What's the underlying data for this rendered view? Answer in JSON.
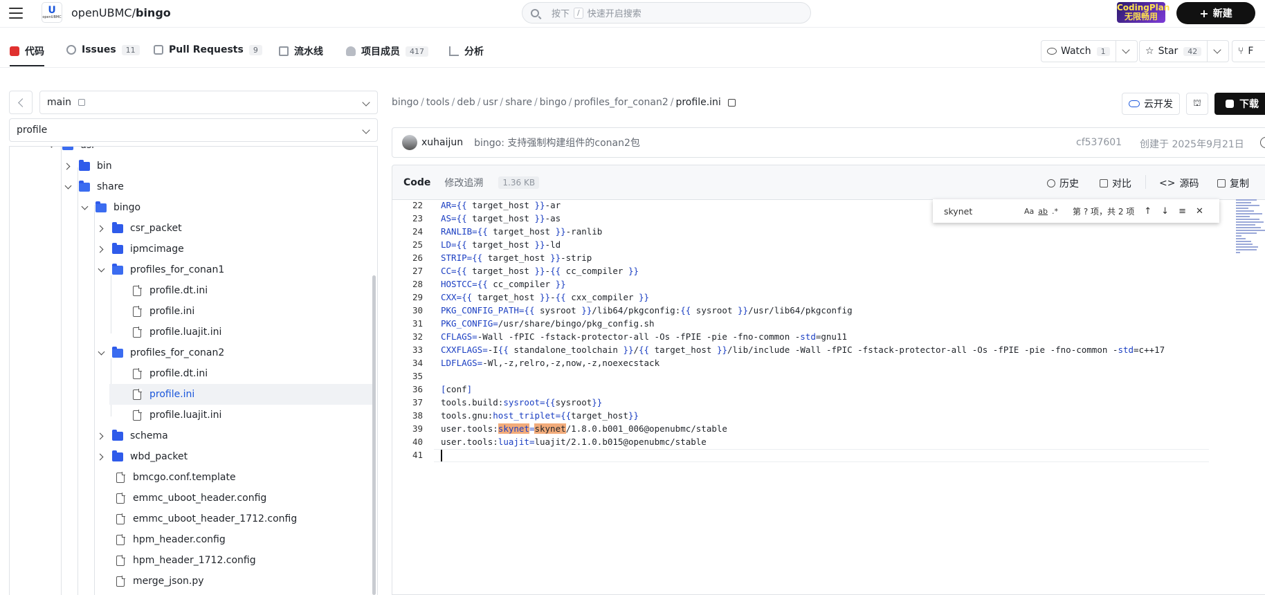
{
  "header": {
    "repo_owner": "openUBMC",
    "repo_sep": "/",
    "repo_name": "bingo",
    "logo_text": "openUBMC",
    "search": {
      "prefix": "按下",
      "key": "/",
      "suffix": "快速开启搜索"
    },
    "promo": {
      "line1": "CodingPlan",
      "line2": "无限畅用"
    },
    "new_label": "新建"
  },
  "tabs": [
    {
      "label": "代码",
      "count": null,
      "icon": "code-icon"
    },
    {
      "label": "Issues",
      "count": "11",
      "icon": "issue-icon"
    },
    {
      "label": "Pull Requests",
      "count": "9",
      "icon": "pr-icon"
    },
    {
      "label": "流水线",
      "count": null,
      "icon": "pipeline-icon"
    },
    {
      "label": "项目成员",
      "count": "417",
      "icon": "members-icon"
    },
    {
      "label": "分析",
      "count": null,
      "icon": "chart-icon"
    }
  ],
  "repo_actions": {
    "watch_label": "Watch",
    "watch_count": "1",
    "star_label": "Star",
    "star_count": "42",
    "fork_label": "F"
  },
  "branch": {
    "name": "main"
  },
  "filter": {
    "value": "profile"
  },
  "tree": [
    {
      "label": "usr",
      "type": "folder",
      "state": "open"
    },
    {
      "label": "bin",
      "type": "folder",
      "state": "closed"
    },
    {
      "label": "share",
      "type": "folder",
      "state": "open"
    },
    {
      "label": "bingo",
      "type": "folder",
      "state": "open"
    },
    {
      "label": "csr_packet",
      "type": "folder",
      "state": "closed"
    },
    {
      "label": "ipmcimage",
      "type": "folder",
      "state": "closed"
    },
    {
      "label": "profiles_for_conan1",
      "type": "folder",
      "state": "open"
    },
    {
      "label": "profile.dt.ini",
      "type": "file"
    },
    {
      "label": "profile.ini",
      "type": "file"
    },
    {
      "label": "profile.luajit.ini",
      "type": "file"
    },
    {
      "label": "profiles_for_conan2",
      "type": "folder",
      "state": "open"
    },
    {
      "label": "profile.dt.ini",
      "type": "file"
    },
    {
      "label": "profile.ini",
      "type": "file",
      "selected": true
    },
    {
      "label": "profile.luajit.ini",
      "type": "file"
    },
    {
      "label": "schema",
      "type": "folder",
      "state": "closed"
    },
    {
      "label": "wbd_packet",
      "type": "folder",
      "state": "closed"
    },
    {
      "label": "bmcgo.conf.template",
      "type": "file"
    },
    {
      "label": "emmc_uboot_header.config",
      "type": "file"
    },
    {
      "label": "emmc_uboot_header_1712.config",
      "type": "file"
    },
    {
      "label": "hpm_header.config",
      "type": "file"
    },
    {
      "label": "hpm_header_1712.config",
      "type": "file"
    },
    {
      "label": "merge_json.py",
      "type": "file"
    }
  ],
  "breadcrumb": [
    "bingo",
    "tools",
    "deb",
    "usr",
    "share",
    "bingo",
    "profiles_for_conan2",
    "profile.ini"
  ],
  "file_actions": {
    "cloud_label": "云开发",
    "download_label": "下载"
  },
  "commit": {
    "author": "xuhaijun",
    "message": "bingo: 支持强制构建组件的conan2包",
    "hash": "cf537601",
    "date": "创建于 2025年9月21日"
  },
  "code_header": {
    "tab_code": "Code",
    "tab_blame": "修改追溯",
    "size": "1.36 KB",
    "history": "历史",
    "compare": "对比",
    "source": "源码",
    "copy": "复制"
  },
  "find_widget": {
    "query": "skynet",
    "opt_case": "Aa",
    "opt_word": "ab",
    "opt_regex": ".*",
    "result": "第 ? 项，共 2 项"
  },
  "code_lines": [
    {
      "n": "22",
      "segs": [
        [
          "k",
          "AR="
        ],
        [
          "k",
          "{{"
        ],
        [
          "t",
          " target_host "
        ],
        [
          "k",
          "}}"
        ],
        [
          "t",
          "-ar"
        ]
      ]
    },
    {
      "n": "23",
      "segs": [
        [
          "k",
          "AS="
        ],
        [
          "k",
          "{{"
        ],
        [
          "t",
          " target_host "
        ],
        [
          "k",
          "}}"
        ],
        [
          "t",
          "-as"
        ]
      ]
    },
    {
      "n": "24",
      "segs": [
        [
          "k",
          "RANLIB="
        ],
        [
          "k",
          "{{"
        ],
        [
          "t",
          " target_host "
        ],
        [
          "k",
          "}}"
        ],
        [
          "t",
          "-ranlib"
        ]
      ]
    },
    {
      "n": "25",
      "segs": [
        [
          "k",
          "LD="
        ],
        [
          "k",
          "{{"
        ],
        [
          "t",
          " target_host "
        ],
        [
          "k",
          "}}"
        ],
        [
          "t",
          "-ld"
        ]
      ]
    },
    {
      "n": "26",
      "segs": [
        [
          "k",
          "STRIP="
        ],
        [
          "k",
          "{{"
        ],
        [
          "t",
          " target_host "
        ],
        [
          "k",
          "}}"
        ],
        [
          "t",
          "-strip"
        ]
      ]
    },
    {
      "n": "27",
      "segs": [
        [
          "k",
          "CC="
        ],
        [
          "k",
          "{{"
        ],
        [
          "t",
          " target_host "
        ],
        [
          "k",
          "}}"
        ],
        [
          "t",
          "-"
        ],
        [
          "k",
          "{{"
        ],
        [
          "t",
          " cc_compiler "
        ],
        [
          "k",
          "}}"
        ]
      ]
    },
    {
      "n": "28",
      "segs": [
        [
          "k",
          "HOSTCC="
        ],
        [
          "k",
          "{{"
        ],
        [
          "t",
          " cc_compiler "
        ],
        [
          "k",
          "}}"
        ]
      ]
    },
    {
      "n": "29",
      "segs": [
        [
          "k",
          "CXX="
        ],
        [
          "k",
          "{{"
        ],
        [
          "t",
          " target_host "
        ],
        [
          "k",
          "}}"
        ],
        [
          "t",
          "-"
        ],
        [
          "k",
          "{{"
        ],
        [
          "t",
          " cxx_compiler "
        ],
        [
          "k",
          "}}"
        ]
      ]
    },
    {
      "n": "30",
      "segs": [
        [
          "k",
          "PKG_CONFIG_PATH="
        ],
        [
          "k",
          "{{"
        ],
        [
          "t",
          " sysroot "
        ],
        [
          "k",
          "}}"
        ],
        [
          "t",
          "/lib64/pkgconfig:"
        ],
        [
          "k",
          "{{"
        ],
        [
          "t",
          " sysroot "
        ],
        [
          "k",
          "}}"
        ],
        [
          "t",
          "/usr/lib64/pkgconfig"
        ]
      ]
    },
    {
      "n": "31",
      "segs": [
        [
          "k",
          "PKG_CONFIG="
        ],
        [
          "t",
          "/usr/share/bingo/pkg_config.sh"
        ]
      ]
    },
    {
      "n": "32",
      "segs": [
        [
          "k",
          "CFLAGS="
        ],
        [
          "t",
          "-Wall -fPIC -fstack-protector-all -Os -fPIE -pie -fno-common -"
        ],
        [
          "k",
          "std"
        ],
        [
          "t",
          "=gnu11"
        ]
      ]
    },
    {
      "n": "33",
      "segs": [
        [
          "k",
          "CXXFLAGS="
        ],
        [
          "t",
          "-I"
        ],
        [
          "k",
          "{{"
        ],
        [
          "t",
          " standalone_toolchain "
        ],
        [
          "k",
          "}}"
        ],
        [
          "t",
          "/"
        ],
        [
          "k",
          "{{"
        ],
        [
          "t",
          " target_host "
        ],
        [
          "k",
          "}}"
        ],
        [
          "t",
          "/lib/include -Wall -fPIC -fstack-protector-all -Os -fPIE -pie -fno-common -"
        ],
        [
          "k",
          "std"
        ],
        [
          "t",
          "=c++17"
        ]
      ]
    },
    {
      "n": "34",
      "segs": [
        [
          "k",
          "LDFLAGS="
        ],
        [
          "t",
          "-Wl,-z,relro,-z,now,-z,noexecstack"
        ]
      ]
    },
    {
      "n": "35",
      "segs": []
    },
    {
      "n": "36",
      "segs": [
        [
          "k",
          "["
        ],
        [
          "t",
          "conf"
        ],
        [
          "k",
          "]"
        ]
      ]
    },
    {
      "n": "37",
      "segs": [
        [
          "t",
          "tools.build:"
        ],
        [
          "k",
          "sysroot="
        ],
        [
          "k",
          "{{"
        ],
        [
          "t",
          "sysroot"
        ],
        [
          "k",
          "}}"
        ]
      ]
    },
    {
      "n": "38",
      "segs": [
        [
          "t",
          "tools.gnu:"
        ],
        [
          "k",
          "host_triplet="
        ],
        [
          "k",
          "{{"
        ],
        [
          "t",
          "target_host"
        ],
        [
          "k",
          "}}"
        ]
      ]
    },
    {
      "n": "39",
      "segs": [
        [
          "t",
          "user.tools:"
        ],
        [
          "hk",
          "skynet"
        ],
        [
          "k",
          "="
        ],
        [
          "h",
          "skynet"
        ],
        [
          "t",
          "/1.8.0.b001_006@openubmc/stable"
        ]
      ]
    },
    {
      "n": "40",
      "segs": [
        [
          "t",
          "user.tools:"
        ],
        [
          "k",
          "luajit="
        ],
        [
          "t",
          "luajit/2.1.0.b015@openubmc/stable"
        ]
      ]
    },
    {
      "n": "41",
      "segs": []
    }
  ],
  "colors": {
    "accent": "#1a56db",
    "keyword": "#1a3ec2",
    "highlight": "#f2ab7a",
    "primary_button": "#111111"
  }
}
